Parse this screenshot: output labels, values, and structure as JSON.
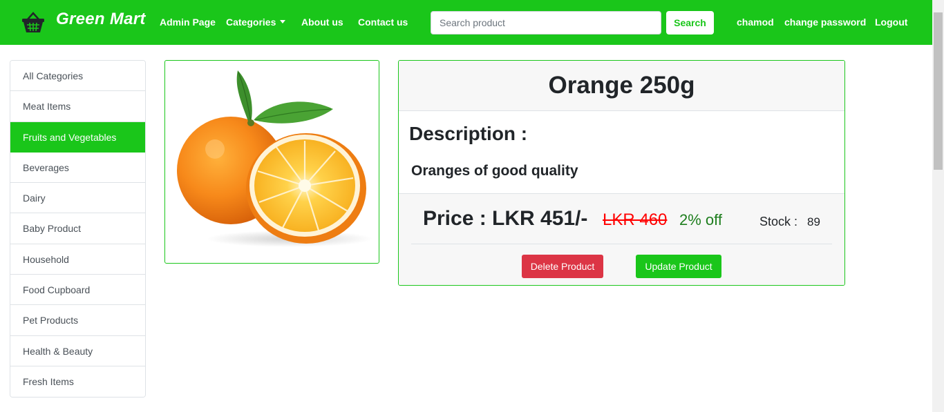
{
  "navbar": {
    "brand": "Green Mart",
    "brand_icon": "basket-icon",
    "links": {
      "admin": "Admin Page",
      "categories": "Categories",
      "about": "About us",
      "contact": "Contact us"
    },
    "search": {
      "placeholder": "Search product",
      "value": "",
      "button": "Search"
    },
    "user": {
      "name": "chamod",
      "change_password": "change password",
      "logout": "Logout"
    },
    "accent_color": "#1ac61a"
  },
  "sidebar": {
    "items": [
      {
        "label": "All Categories"
      },
      {
        "label": "Meat Items"
      },
      {
        "label": "Fruits and Vegetables",
        "active": true
      },
      {
        "label": "Beverages"
      },
      {
        "label": "Dairy"
      },
      {
        "label": "Baby Product"
      },
      {
        "label": "Household"
      },
      {
        "label": "Food Cupboard"
      },
      {
        "label": "Pet Products"
      },
      {
        "label": "Health & Beauty"
      },
      {
        "label": "Fresh Items"
      }
    ]
  },
  "product": {
    "name": "Orange 250g",
    "image": "orange-image",
    "description_label": "Description :",
    "description": "Oranges of good quality",
    "price": "Price : LKR 451/-",
    "old_price": "LKR 460",
    "discount": "2% off",
    "stock_label": "Stock :",
    "stock": "89",
    "delete_button": "Delete Product",
    "update_button": "Update Product"
  }
}
